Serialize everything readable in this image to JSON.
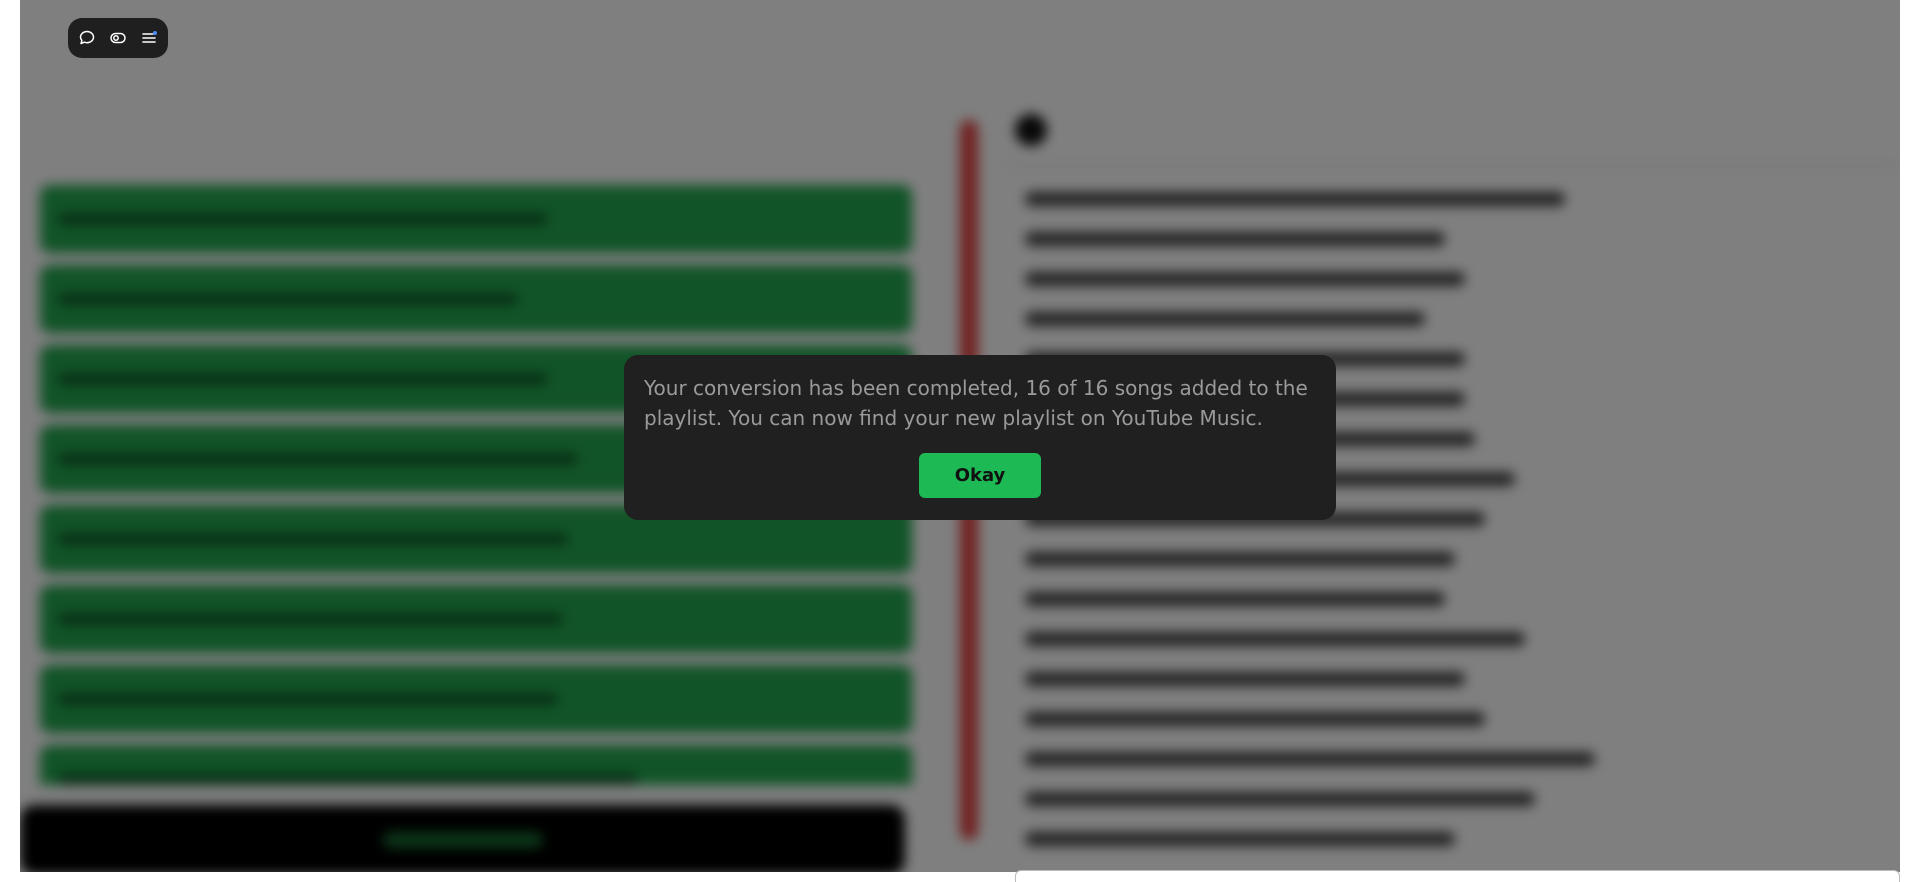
{
  "modal": {
    "message": "Your conversion has been completed, 16 of 16 songs added to the playlist. You can now find your new playlist on YouTube Music.",
    "ok_label": "Okay"
  },
  "toolbar": {
    "icons": [
      "chat-bubble-icon",
      "toggle-icon",
      "menu-icon"
    ],
    "menu_badge_color": "#4c8dff"
  },
  "colors": {
    "accent_green": "#1db954",
    "divider_red": "#e34242",
    "modal_bg": "#202020"
  }
}
